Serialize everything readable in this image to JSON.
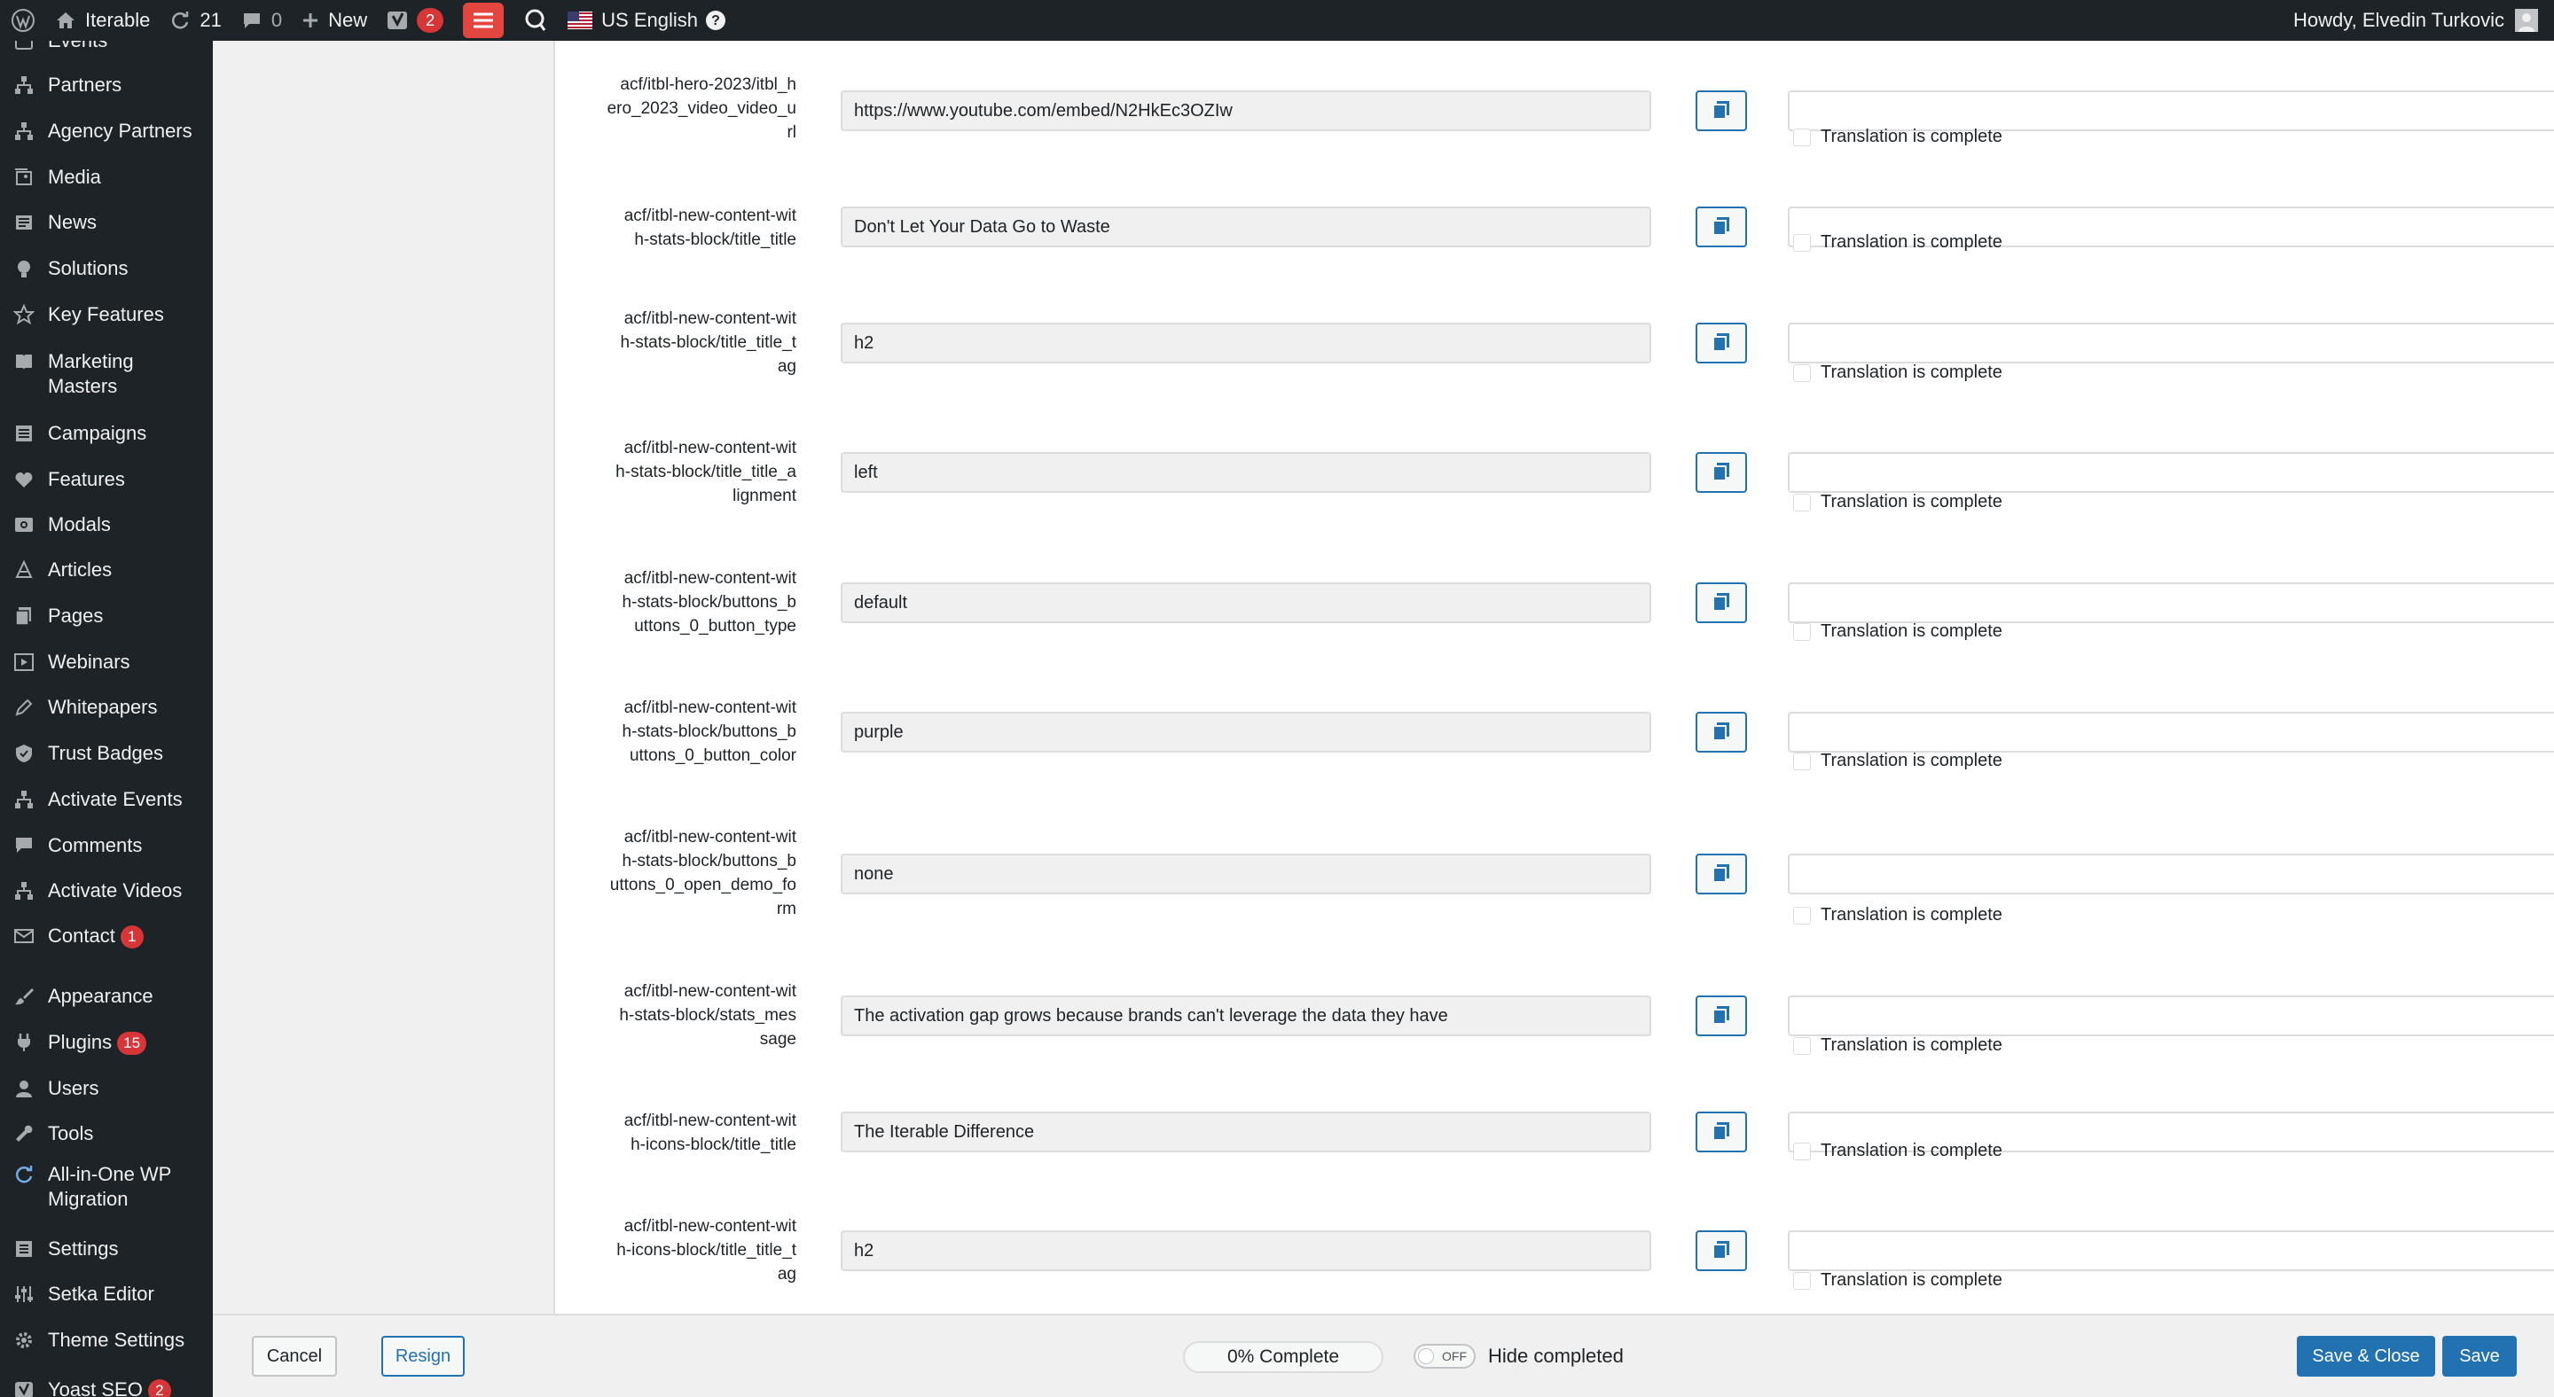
{
  "admin_bar": {
    "site_name": "Iterable",
    "updates_count": "21",
    "comments_count": "0",
    "new_label": "New",
    "yoast_badge": "2",
    "language": "US English",
    "greeting": "Howdy, Elvedin Turkovic"
  },
  "sidebar": {
    "items": [
      {
        "label": "Events",
        "icon": "calendar-icon"
      },
      {
        "label": "Partners",
        "icon": "network-icon"
      },
      {
        "label": "Agency Partners",
        "icon": "network-icon"
      },
      {
        "label": "Media",
        "icon": "media-icon"
      },
      {
        "label": "News",
        "icon": "news-icon"
      },
      {
        "label": "Solutions",
        "icon": "lightbulb-icon"
      },
      {
        "label": "Key Features",
        "icon": "star-icon"
      },
      {
        "label": "Marketing Masters",
        "icon": "book-icon"
      },
      {
        "label": "Campaigns",
        "icon": "list-icon"
      },
      {
        "label": "Features",
        "icon": "heart-icon"
      },
      {
        "label": "Modals",
        "icon": "modal-icon"
      },
      {
        "label": "Articles",
        "icon": "articles-icon"
      },
      {
        "label": "Pages",
        "icon": "pages-icon"
      },
      {
        "label": "Webinars",
        "icon": "video-icon"
      },
      {
        "label": "Whitepapers",
        "icon": "edit-icon"
      },
      {
        "label": "Trust Badges",
        "icon": "shield-icon"
      },
      {
        "label": "Activate Events",
        "icon": "network-icon"
      },
      {
        "label": "Comments",
        "icon": "comment-icon"
      },
      {
        "label": "Activate Videos",
        "icon": "network-icon"
      },
      {
        "label": "Contact",
        "icon": "mail-icon",
        "badge": "1"
      },
      {
        "label": "Appearance",
        "icon": "brush-icon"
      },
      {
        "label": "Plugins",
        "icon": "plug-icon",
        "badge": "15"
      },
      {
        "label": "Users",
        "icon": "user-icon"
      },
      {
        "label": "Tools",
        "icon": "wrench-icon"
      },
      {
        "label": "All-in-One WP Migration",
        "icon": "migration-icon"
      },
      {
        "label": "Settings",
        "icon": "settings-icon"
      },
      {
        "label": "Setka Editor",
        "icon": "sliders-icon"
      },
      {
        "label": "Theme Settings",
        "icon": "gear-icon"
      },
      {
        "label": "Yoast SEO",
        "icon": "yoast-icon",
        "badge": "2"
      }
    ]
  },
  "translation_rows": [
    {
      "field": "acf/itbl-hero-2023/itbl_hero_2023_video_video_url",
      "original": "https://www.youtube.com/embed/N2HkEc3OZIw",
      "translation": "",
      "complete_label": "Translation is complete"
    },
    {
      "field": "acf/itbl-new-content-with-stats-block/title_title",
      "original": "Don't Let Your Data Go to Waste",
      "translation": "",
      "complete_label": "Translation is complete"
    },
    {
      "field": "acf/itbl-new-content-with-stats-block/title_title_tag",
      "original": "h2",
      "translation": "",
      "complete_label": "Translation is complete"
    },
    {
      "field": "acf/itbl-new-content-with-stats-block/title_title_alignment",
      "original": "left",
      "translation": "",
      "complete_label": "Translation is complete"
    },
    {
      "field": "acf/itbl-new-content-with-stats-block/buttons_buttons_0_button_type",
      "original": "default",
      "translation": "",
      "complete_label": "Translation is complete"
    },
    {
      "field": "acf/itbl-new-content-with-stats-block/buttons_buttons_0_button_color",
      "original": "purple",
      "translation": "",
      "complete_label": "Translation is complete"
    },
    {
      "field": "acf/itbl-new-content-with-stats-block/buttons_buttons_0_open_demo_form",
      "original": "none",
      "translation": "",
      "complete_label": "Translation is complete"
    },
    {
      "field": "acf/itbl-new-content-with-stats-block/stats_message",
      "original": "The activation gap grows because brands can't leverage the data they have",
      "translation": "",
      "complete_label": "Translation is complete"
    },
    {
      "field": "acf/itbl-new-content-with-icons-block/title_title",
      "original": "The Iterable Difference",
      "translation": "",
      "complete_label": "Translation is complete"
    },
    {
      "field": "acf/itbl-new-content-with-icons-block/title_title_tag",
      "original": "h2",
      "translation": "",
      "complete_label": "Translation is complete"
    }
  ],
  "footer": {
    "cancel_label": "Cancel",
    "resign_label": "Resign",
    "progress_text": "0% Complete",
    "progress_value": 0,
    "toggle_state": "OFF",
    "hide_completed_label": "Hide completed",
    "save_close_label": "Save & Close",
    "save_label": "Save"
  },
  "colors": {
    "admin_bar_bg": "#1d2327",
    "accent": "#2271b1",
    "badge": "#d63638"
  }
}
